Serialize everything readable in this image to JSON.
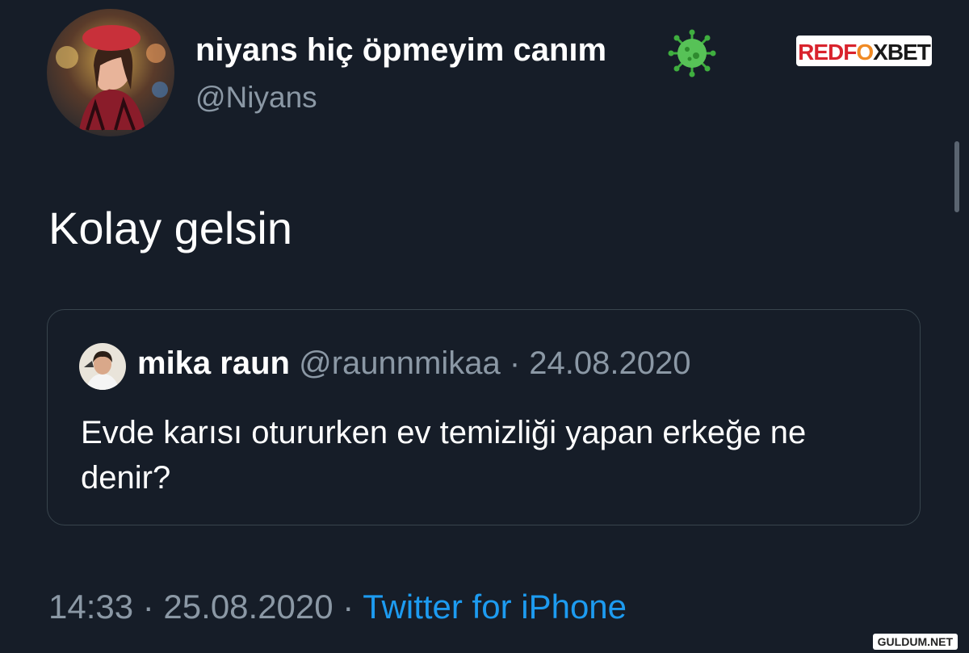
{
  "author": {
    "display_name": "niyans hiç öpmeyim canım",
    "handle": "@Niyans",
    "badge_icon": "virus-icon"
  },
  "brand": {
    "logo_text": "REDFOXBET"
  },
  "tweet": {
    "text": "Kolay gelsin"
  },
  "quoted_tweet": {
    "author_name": "mika raun",
    "meta": "@raunnmikaa · 24.08.2020",
    "text": "Evde karısı otururken ev temizliği yapan erkeğe ne denir?"
  },
  "footer": {
    "time_date": "14:33 · 25.08.2020 · ",
    "source": "Twitter for iPhone"
  },
  "watermark": "GULDUM.NET",
  "colors": {
    "background": "#161d28",
    "secondary_text": "#8b98a5",
    "link": "#1d9bf0",
    "border": "#38444d"
  }
}
